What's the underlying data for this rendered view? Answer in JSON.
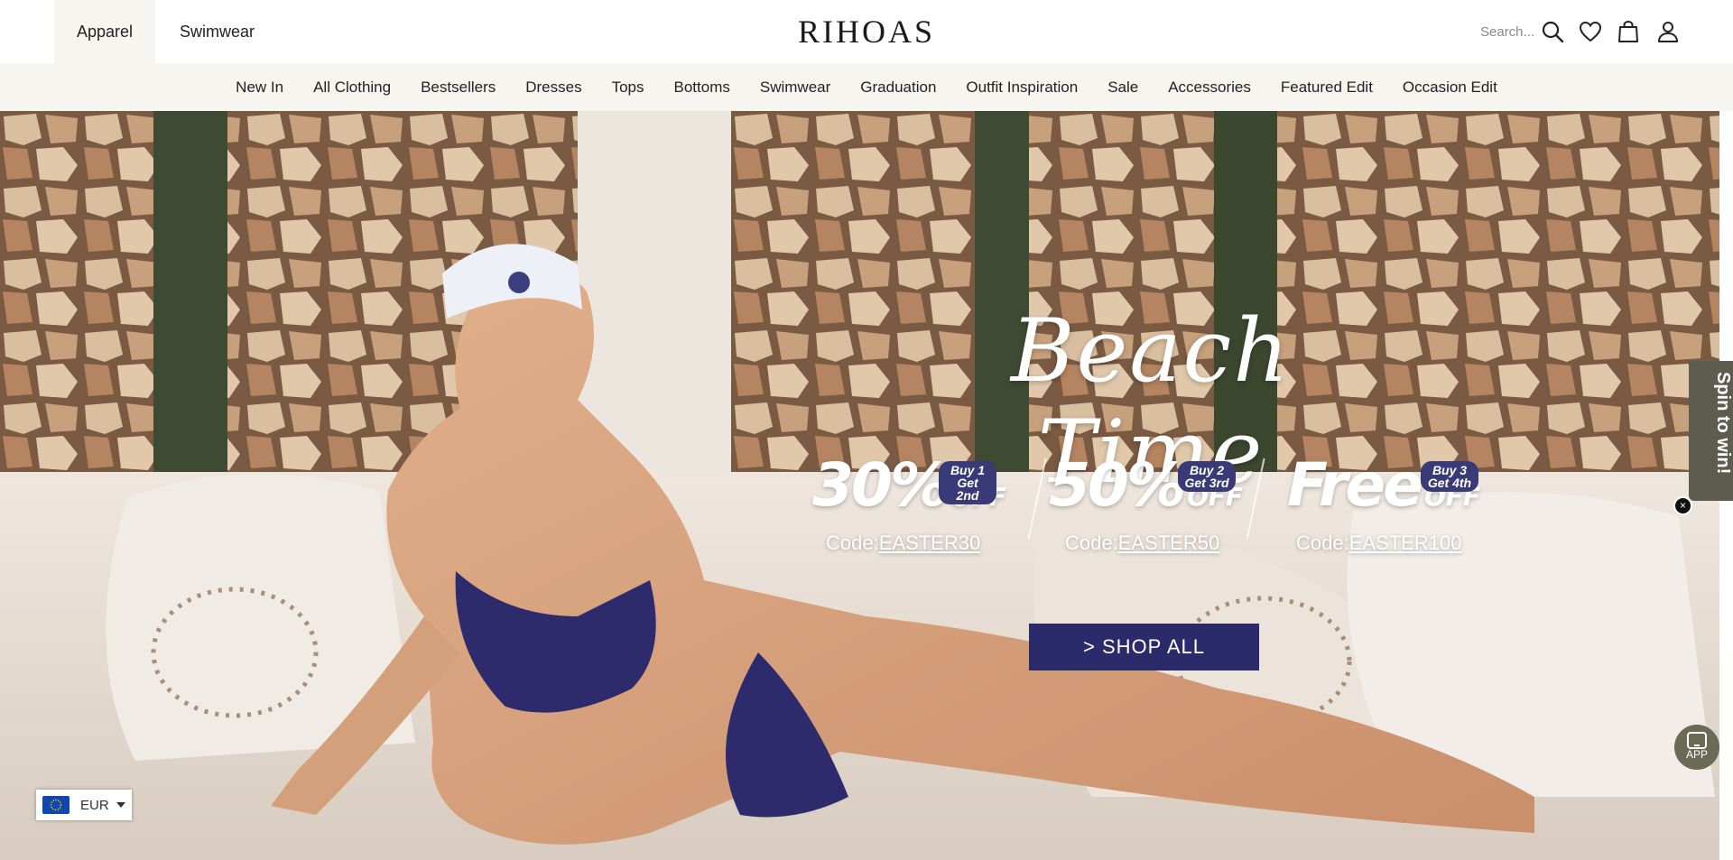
{
  "header": {
    "tabs": [
      {
        "label": "Apparel",
        "active": true
      },
      {
        "label": "Swimwear",
        "active": false
      }
    ],
    "logo": "RIHOAS",
    "search": {
      "placeholder": "Search...",
      "icon": "search-icon"
    },
    "icons": [
      "heart-icon",
      "shopping-bag-icon",
      "user-icon"
    ]
  },
  "nav": {
    "items": [
      "New In",
      "All Clothing",
      "Bestsellers",
      "Dresses",
      "Tops",
      "Bottoms",
      "Swimwear",
      "Graduation",
      "Outfit Inspiration",
      "Sale",
      "Accessories",
      "Featured Edit",
      "Occasion Edit"
    ]
  },
  "hero": {
    "title": "Beach Time",
    "offers": [
      {
        "value": "30%",
        "off": "OFF",
        "badge_line1": "Buy 1",
        "badge_line2": "Get 2nd",
        "code_prefix": "Code:",
        "code": "EASTER30"
      },
      {
        "value": "50%",
        "off": "OFF",
        "badge_line1": "Buy 2",
        "badge_line2": "Get 3rd",
        "code_prefix": "Code:",
        "code": "EASTER50"
      },
      {
        "value": "Free",
        "off": "OFF",
        "badge_line1": "Buy 3",
        "badge_line2": "Get 4th",
        "code_prefix": "Code:",
        "code": "EASTER100"
      }
    ],
    "cta": "> SHOP ALL"
  },
  "widgets": {
    "spin": "Spin to win!",
    "spin_close": "×",
    "app": "APP",
    "currency": "EUR"
  },
  "colors": {
    "nav_bg": "#f6f5f0",
    "cta_bg": "#2b2a6b",
    "badge_bg": "#3a3a78",
    "spin_bg": "#5d5d4f"
  }
}
